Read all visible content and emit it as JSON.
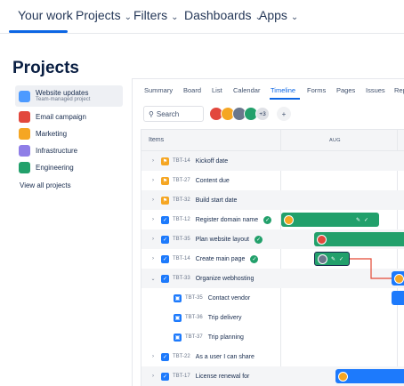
{
  "topnav": {
    "your_work": "Your work",
    "projects": "Projects",
    "filters": "Filters",
    "dashboards": "Dashboards",
    "apps": "Apps",
    "chevron_icon": "chevron-down-icon"
  },
  "page": {
    "title": "Projects"
  },
  "sidebar": {
    "items": [
      {
        "label": "Website updates",
        "sublabel": "Team-managed project",
        "icon": "website-project-icon",
        "color": "#4c9aff",
        "active": true
      },
      {
        "label": "Email campaign",
        "icon": "email-project-icon",
        "color": "#e2483d"
      },
      {
        "label": "Marketing",
        "icon": "marketing-project-icon",
        "color": "#f5a623"
      },
      {
        "label": "Infrastructure",
        "icon": "infrastructure-project-icon",
        "color": "#8f7ee7"
      },
      {
        "label": "Engineering",
        "icon": "engineering-project-icon",
        "color": "#22a06b"
      }
    ],
    "view_all": "View all projects"
  },
  "tabs": [
    "Summary",
    "Board",
    "List",
    "Calendar",
    "Timeline",
    "Forms",
    "Pages",
    "Issues",
    "Rep"
  ],
  "active_tab": "Timeline",
  "search": {
    "placeholder": "Search"
  },
  "avatars": {
    "more": "+3",
    "colors": [
      "#e2483d",
      "#f5a623",
      "#6b778c",
      "#22a06b"
    ]
  },
  "timeline": {
    "items_header": "Items",
    "month": "AUG",
    "rows": [
      {
        "key": "TBT-14",
        "title": "Kickoff date",
        "type": "milestone",
        "caret": "›"
      },
      {
        "key": "TBT-27",
        "title": "Content due",
        "type": "milestone",
        "caret": "›"
      },
      {
        "key": "TBT-32",
        "title": "Build start date",
        "type": "milestone",
        "caret": "›"
      },
      {
        "key": "TBT-12",
        "title": "Register domain name",
        "type": "task",
        "caret": "›",
        "done": true
      },
      {
        "key": "TBT-35",
        "title": "Plan website layout",
        "type": "task",
        "caret": "›",
        "done": true
      },
      {
        "key": "TBT-14",
        "title": "Create main page",
        "type": "task",
        "caret": "›",
        "done": true
      },
      {
        "key": "TBT-33",
        "title": "Organize webhosting",
        "type": "task",
        "caret": "⌄"
      },
      {
        "key": "TBT-35",
        "title": "Contact vendor",
        "type": "subtask",
        "caret": ""
      },
      {
        "key": "TBT-36",
        "title": "Trip delivery",
        "type": "subtask",
        "caret": ""
      },
      {
        "key": "TBT-37",
        "title": "Trip planning",
        "type": "subtask",
        "caret": ""
      },
      {
        "key": "TBT-22",
        "title": "As a user I can share",
        "type": "task",
        "caret": "›"
      },
      {
        "key": "TBT-17",
        "title": "License renewal for",
        "type": "task",
        "caret": "›"
      }
    ]
  },
  "colors": {
    "accent": "#0c66e4",
    "green_bar": "#22a06b",
    "blue_bar": "#1d7afc",
    "dependency_line": "#e34935"
  }
}
